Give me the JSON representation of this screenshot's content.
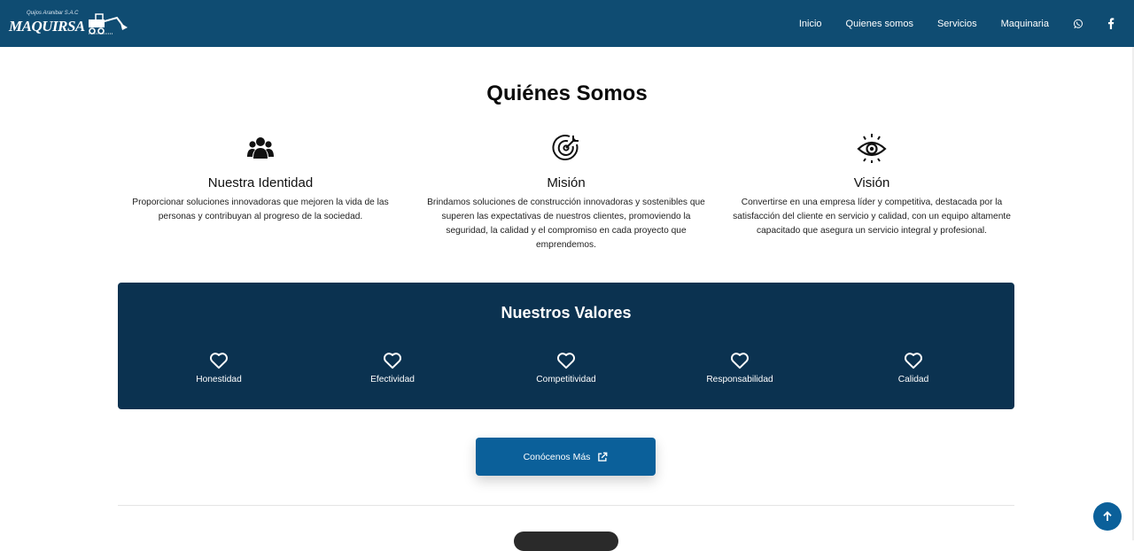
{
  "brand": {
    "name": "MAQUIRSA",
    "tagline": "Quijos Aranibar S.A.C"
  },
  "nav": {
    "links": [
      "Inicio",
      "Quienes somos",
      "Servicios",
      "Maquinaria"
    ],
    "icons": [
      "whatsapp-icon",
      "facebook-icon"
    ]
  },
  "about": {
    "title": "Quiénes Somos",
    "pillars": [
      {
        "icon": "users-icon",
        "title": "Nuestra Identidad",
        "text": "Proporcionar soluciones innovadoras que mejoren la vida de las personas y contribuyan al progreso de la sociedad."
      },
      {
        "icon": "target-icon",
        "title": "Misión",
        "text": "Brindamos soluciones de construcción innovadoras y sostenibles que superen las expectativas de nuestros clientes, promoviendo la seguridad, la calidad y el compromiso en cada proyecto que emprendemos."
      },
      {
        "icon": "eye-icon",
        "title": "Visión",
        "text": "Convertirse en una empresa líder y competitiva, destacada por la satisfacción del cliente en servicio y calidad, con un equipo altamente capacitado que asegura un servicio integral y profesional."
      }
    ]
  },
  "values": {
    "title": "Nuestros Valores",
    "items": [
      "Honestidad",
      "Efectividad",
      "Competitividad",
      "Responsabilidad",
      "Calidad"
    ]
  },
  "cta": {
    "label": "Conócenos Más",
    "icon": "external-link-icon"
  },
  "back_to_top": {
    "icon": "arrow-up-icon"
  },
  "colors": {
    "navbar": "#0f4c72",
    "values_bg": "#0b3250",
    "button": "#0b609a"
  }
}
